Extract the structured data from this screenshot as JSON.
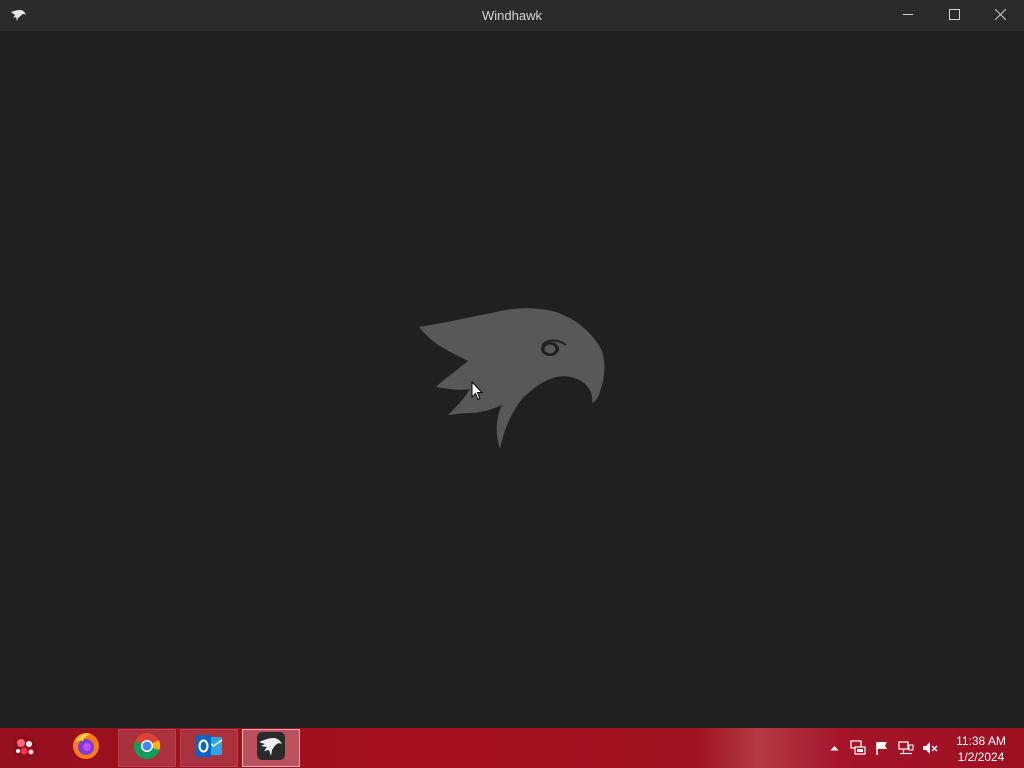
{
  "window": {
    "title": "Windhawk",
    "app_icon": "windhawk-eagle-icon",
    "controls": {
      "minimize_icon": "minimize-icon",
      "maximize_icon": "maximize-icon",
      "close_icon": "close-icon"
    }
  },
  "content": {
    "splash_logo": "windhawk-eagle-logo"
  },
  "taskbar": {
    "start_icon": "start-orb-icon",
    "pinned": [
      {
        "name": "Firefox",
        "icon": "firefox-icon"
      },
      {
        "name": "Chrome",
        "icon": "chrome-icon"
      },
      {
        "name": "Outlook",
        "icon": "outlook-icon"
      },
      {
        "name": "Windhawk",
        "icon": "windhawk-icon"
      }
    ],
    "tray": {
      "icons": [
        "chevron-up-icon",
        "network-share-icon",
        "flag-icon",
        "network-icon",
        "volume-muted-icon"
      ],
      "time": "11:38 AM",
      "date": "1/2/2024"
    }
  },
  "colors": {
    "window_bg": "#202020",
    "titlebar_bg": "#2b2b2b",
    "logo": "#5a5a5a",
    "taskbar": "#a5101f"
  }
}
